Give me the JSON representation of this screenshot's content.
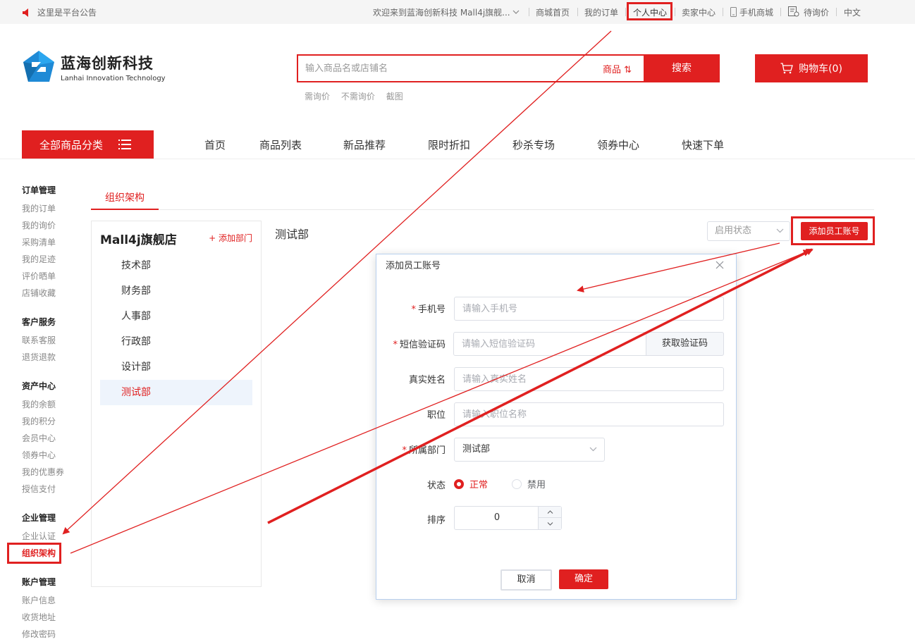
{
  "topbar": {
    "announcement": "这里是平台公告",
    "welcome": "欢迎来到蓝海创新科技 Mall4j旗舰...",
    "links": [
      "商城首页",
      "我的订单",
      "个人中心",
      "卖家中心",
      "手机商城",
      "待询价",
      "中文"
    ]
  },
  "header": {
    "brand_cn": "蓝海创新科技",
    "brand_en": "Lanhai Innovation Technology",
    "search_placeholder": "输入商品名或店铺名",
    "search_type": "商品 ⇅",
    "search_button": "搜索",
    "hot_words": [
      "需询价",
      "不需询价",
      "截图"
    ],
    "cart_label": "购物车(0)"
  },
  "nav": {
    "all_categories": "全部商品分类",
    "items": [
      "首页",
      "商品列表",
      "新品推荐",
      "限时折扣",
      "秒杀专场",
      "领券中心",
      "快速下单"
    ]
  },
  "sidebar": {
    "groups": [
      {
        "title": "订单管理",
        "items": [
          "我的订单",
          "我的询价",
          "采购清单",
          "我的足迹",
          "评价晒单",
          "店铺收藏"
        ]
      },
      {
        "title": "客户服务",
        "items": [
          "联系客服",
          "退货退款"
        ]
      },
      {
        "title": "资产中心",
        "items": [
          "我的余额",
          "我的积分",
          "会员中心",
          "领券中心",
          "我的优惠券",
          "授信支付"
        ]
      },
      {
        "title": "企业管理",
        "items": [
          "企业认证",
          "组织架构"
        ]
      },
      {
        "title": "账户管理",
        "items": [
          "账户信息",
          "收货地址",
          "修改密码"
        ]
      }
    ]
  },
  "main": {
    "tab": "组织架构",
    "store_name": "Mall4j旗舰店",
    "add_dept": "+ 添加部门",
    "departments": [
      "技术部",
      "财务部",
      "人事部",
      "行政部",
      "设计部",
      "测试部"
    ],
    "selected_dept": "测试部",
    "status_placeholder": "启用状态",
    "add_employee": "添加员工账号"
  },
  "dialog": {
    "title": "添加员工账号",
    "phone_label": "手机号",
    "phone_placeholder": "请输入手机号",
    "sms_label": "短信验证码",
    "sms_placeholder": "请输入短信验证码",
    "sms_button": "获取验证码",
    "name_label": "真实姓名",
    "name_placeholder": "请输入真实姓名",
    "position_label": "职位",
    "position_placeholder": "请输入职位名称",
    "dept_label": "所属部门",
    "dept_value": "测试部",
    "status_label": "状态",
    "status_normal": "正常",
    "status_disabled": "禁用",
    "sort_label": "排序",
    "sort_value": "0",
    "cancel": "取消",
    "confirm": "确定"
  },
  "colors": {
    "accent": "#e02020",
    "annotation": "#e02020"
  }
}
